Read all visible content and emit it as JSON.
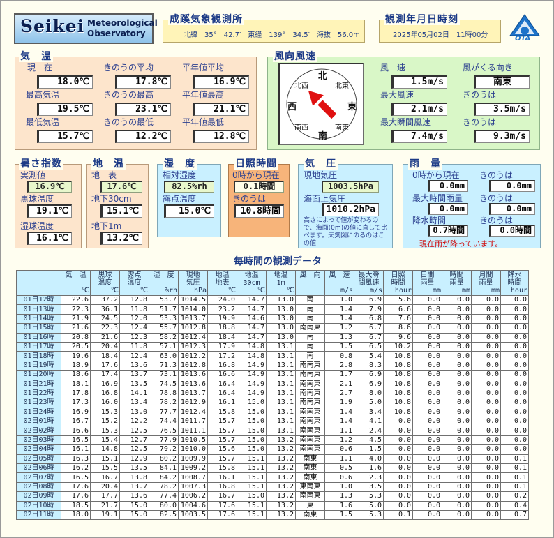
{
  "logo": {
    "word": "Seikei",
    "line1": "Meteorological",
    "line2": "Observatory"
  },
  "station": {
    "title": "成蹊気象観測所",
    "coords": "北緯　35°　42.7′　東経　139°　34.5′　海抜　56.0m"
  },
  "datetime": {
    "title": "観測年月日時刻",
    "value": "2025年05月02日　11時00分"
  },
  "corner_logo": "OTA",
  "temp": {
    "title": "気　温",
    "now_label": "現　在",
    "now": "18.0℃",
    "yavg_label": "きのうの平均",
    "yavg": "17.8℃",
    "navg_label": "平年値平均",
    "navg": "16.9℃",
    "max_label": "最高気温",
    "max": "19.5℃",
    "ymax_label": "きのうの最高",
    "ymax": "23.1℃",
    "nmax_label": "平年値最高",
    "nmax": "21.1℃",
    "min_label": "最低気温",
    "min": "15.7℃",
    "ymin_label": "きのうの最低",
    "ymin": "12.2℃",
    "nmin_label": "平年値最低",
    "nmin": "12.8℃"
  },
  "wind": {
    "title": "風向風速",
    "compass": {
      "n": "北",
      "s": "南",
      "e": "東",
      "w": "西",
      "nw": "北西",
      "ne": "北東",
      "sw": "南西",
      "se": "南東"
    },
    "speed_label": "風　速",
    "speed": "1.5m/s",
    "blow_label": "風がくる向き",
    "blow": "南東",
    "max_label": "最大風速",
    "max": "2.1m/s",
    "ymax_label": "きのうは",
    "ymax": "3.5m/s",
    "gust_label": "最大瞬間風速",
    "gust": "7.4m/s",
    "ygust_label": "きのうは",
    "ygust": "9.3m/s",
    "arrow_color": "#e01010"
  },
  "heat": {
    "title": "暑さ指数",
    "v1_label": "実測値",
    "v1": "16.9℃",
    "v2_label": "黒球温度",
    "v2": "19.1℃",
    "v3_label": "湿球温度",
    "v3": "16.1℃"
  },
  "soil": {
    "title": "地　温",
    "v1_label": "地　表",
    "v1": "17.6℃",
    "v2_label": "地下30cm",
    "v2": "15.1℃",
    "v3_label": "地下1m",
    "v3": "13.2℃"
  },
  "humidity": {
    "title": "湿　度",
    "rh_label": "相対湿度",
    "rh": "82.5%rh",
    "dew_label": "露点温度",
    "dew": "15.0℃"
  },
  "sunshine": {
    "title": "日照時間",
    "since_label": "0時から現在",
    "since": "0.1時間",
    "yest_label": "きのうは",
    "yest": "10.8時間"
  },
  "pressure": {
    "title": "気　圧",
    "stn_label": "現地気圧",
    "stn": "1003.5hPa",
    "sea_label": "海面上気圧",
    "sea": "1010.2hPa",
    "note": "高さによって値が変わるので、海面(0m)の値に直して比べます。天気図にのるのはこの値"
  },
  "rain": {
    "title": "雨　量",
    "since_label": "0時から現在",
    "since": "0.0mm",
    "ysince_label": "きのうは",
    "ysince": "0.0mm",
    "maxh_label": "最大時間雨量",
    "maxh": "0.0mm",
    "ymaxh_label": "きのうは",
    "ymaxh": "0.0mm",
    "dur_label": "降水時間",
    "dur": "0.7時間",
    "ydur_label": "きのうは",
    "ydur": "0.0時間",
    "status": "現在雨が降っています。"
  },
  "table": {
    "title": "毎時間の観測データ",
    "headers": [
      [
        "",
        "気　温",
        "",
        "℃"
      ],
      [
        "",
        "黒球",
        "温度",
        "℃"
      ],
      [
        "",
        "露点",
        "温度",
        "℃"
      ],
      [
        "",
        "湿　度",
        "",
        "%rh"
      ],
      [
        "",
        "現地",
        "気圧",
        "hPa"
      ],
      [
        "",
        "地温",
        "地表",
        "℃"
      ],
      [
        "",
        "地温",
        "30cm",
        "℃"
      ],
      [
        "",
        "地温",
        "1m",
        "℃"
      ],
      [
        "",
        "風　向",
        "",
        ""
      ],
      [
        "",
        "風　速",
        "",
        "m/s"
      ],
      [
        "",
        "最大瞬",
        "間風速",
        "m/s"
      ],
      [
        "",
        "日照",
        "時間",
        "hour"
      ],
      [
        "",
        "日間",
        "雨量",
        "mm"
      ],
      [
        "",
        "時間",
        "雨量",
        "mm"
      ],
      [
        "",
        "月間",
        "雨量",
        "mm"
      ],
      [
        "",
        "降水",
        "時間",
        "hour"
      ]
    ],
    "rows": [
      [
        "01日12時",
        "22.6",
        "37.2",
        "12.8",
        "53.7",
        "1014.5",
        "24.0",
        "14.7",
        "13.0",
        "南",
        "1.0",
        "6.9",
        "5.6",
        "0.0",
        "0.0",
        "0.0",
        "0.0"
      ],
      [
        "01日13時",
        "22.3",
        "36.1",
        "11.8",
        "51.7",
        "1014.0",
        "23.2",
        "14.7",
        "13.0",
        "南",
        "1.4",
        "7.9",
        "6.6",
        "0.0",
        "0.0",
        "0.0",
        "0.0"
      ],
      [
        "01日14時",
        "21.9",
        "24.5",
        "12.0",
        "53.3",
        "1013.7",
        "19.9",
        "14.6",
        "13.0",
        "南",
        "1.4",
        "6.8",
        "7.6",
        "0.0",
        "0.0",
        "0.0",
        "0.0"
      ],
      [
        "01日15時",
        "21.6",
        "22.3",
        "12.4",
        "55.7",
        "1012.8",
        "18.8",
        "14.7",
        "13.0",
        "南南東",
        "1.2",
        "6.7",
        "8.6",
        "0.0",
        "0.0",
        "0.0",
        "0.0"
      ],
      [
        "01日16時",
        "20.8",
        "21.6",
        "12.3",
        "58.2",
        "1012.4",
        "18.4",
        "14.7",
        "13.0",
        "南",
        "1.3",
        "6.7",
        "9.6",
        "0.0",
        "0.0",
        "0.0",
        "0.0"
      ],
      [
        "01日17時",
        "20.5",
        "20.4",
        "11.8",
        "57.1",
        "1012.3",
        "17.9",
        "14.8",
        "13.1",
        "南",
        "1.5",
        "6.5",
        "10.2",
        "0.0",
        "0.0",
        "0.0",
        "0.0"
      ],
      [
        "01日18時",
        "19.6",
        "18.4",
        "12.4",
        "63.0",
        "1012.2",
        "17.2",
        "14.8",
        "13.1",
        "南",
        "0.8",
        "5.4",
        "10.8",
        "0.0",
        "0.0",
        "0.0",
        "0.0"
      ],
      [
        "01日19時",
        "18.9",
        "17.6",
        "13.6",
        "71.3",
        "1012.8",
        "16.8",
        "14.9",
        "13.1",
        "南南東",
        "2.8",
        "8.3",
        "10.8",
        "0.0",
        "0.0",
        "0.0",
        "0.0"
      ],
      [
        "01日20時",
        "18.6",
        "17.4",
        "13.7",
        "73.1",
        "1013.6",
        "16.6",
        "14.9",
        "13.1",
        "南南東",
        "1.7",
        "6.9",
        "10.8",
        "0.0",
        "0.0",
        "0.0",
        "0.0"
      ],
      [
        "01日21時",
        "18.1",
        "16.9",
        "13.5",
        "74.5",
        "1013.6",
        "16.4",
        "14.9",
        "13.1",
        "南南東",
        "2.1",
        "6.9",
        "10.8",
        "0.0",
        "0.0",
        "0.0",
        "0.0"
      ],
      [
        "01日22時",
        "17.8",
        "16.8",
        "14.1",
        "78.8",
        "1013.7",
        "16.4",
        "14.9",
        "13.1",
        "南南東",
        "2.7",
        "8.0",
        "10.8",
        "0.0",
        "0.0",
        "0.0",
        "0.0"
      ],
      [
        "01日23時",
        "17.3",
        "16.0",
        "13.4",
        "78.2",
        "1012.9",
        "16.1",
        "15.0",
        "13.1",
        "南南東",
        "1.9",
        "5.0",
        "10.8",
        "0.0",
        "0.0",
        "0.0",
        "0.0"
      ],
      [
        "01日24時",
        "16.9",
        "15.3",
        "13.0",
        "77.7",
        "1012.4",
        "15.8",
        "15.0",
        "13.1",
        "南南東",
        "1.4",
        "3.4",
        "10.8",
        "0.0",
        "0.0",
        "0.0",
        "0.0"
      ],
      [
        "02日01時",
        "16.7",
        "15.2",
        "12.2",
        "74.4",
        "1011.7",
        "15.7",
        "15.0",
        "13.1",
        "南南東",
        "1.4",
        "4.1",
        "0.0",
        "0.0",
        "0.0",
        "0.0",
        "0.0"
      ],
      [
        "02日02時",
        "16.6",
        "15.3",
        "12.5",
        "76.5",
        "1011.1",
        "15.7",
        "15.0",
        "13.1",
        "南南東",
        "1.1",
        "2.4",
        "0.0",
        "0.0",
        "0.0",
        "0.0",
        "0.0"
      ],
      [
        "02日03時",
        "16.5",
        "15.4",
        "12.7",
        "77.9",
        "1010.5",
        "15.7",
        "15.0",
        "13.2",
        "南南東",
        "1.2",
        "4.5",
        "0.0",
        "0.0",
        "0.0",
        "0.0",
        "0.0"
      ],
      [
        "02日04時",
        "16.1",
        "14.8",
        "12.5",
        "79.2",
        "1010.0",
        "15.6",
        "15.0",
        "13.2",
        "南南東",
        "0.6",
        "1.5",
        "0.0",
        "0.0",
        "0.0",
        "0.0",
        "0.0"
      ],
      [
        "02日05時",
        "16.3",
        "15.1",
        "12.9",
        "80.2",
        "1009.9",
        "15.7",
        "15.1",
        "13.2",
        "南東",
        "1.1",
        "4.0",
        "0.0",
        "0.0",
        "0.0",
        "0.0",
        "0.1"
      ],
      [
        "02日06時",
        "16.2",
        "15.5",
        "13.5",
        "84.1",
        "1009.2",
        "15.8",
        "15.1",
        "13.2",
        "南東",
        "0.5",
        "1.6",
        "0.0",
        "0.0",
        "0.0",
        "0.0",
        "0.1"
      ],
      [
        "02日07時",
        "16.5",
        "16.7",
        "13.8",
        "84.2",
        "1008.7",
        "16.1",
        "15.1",
        "13.2",
        "南東",
        "0.6",
        "2.3",
        "0.0",
        "0.0",
        "0.0",
        "0.0",
        "0.1"
      ],
      [
        "02日08時",
        "17.6",
        "20.4",
        "13.7",
        "78.2",
        "1007.3",
        "16.8",
        "15.1",
        "13.2",
        "東南東",
        "1.0",
        "3.5",
        "0.0",
        "0.0",
        "0.0",
        "0.0",
        "0.1"
      ],
      [
        "02日09時",
        "17.6",
        "17.7",
        "13.6",
        "77.4",
        "1006.2",
        "16.7",
        "15.0",
        "13.2",
        "南南東",
        "1.3",
        "5.3",
        "0.0",
        "0.0",
        "0.0",
        "0.0",
        "0.2"
      ],
      [
        "02日10時",
        "18.5",
        "21.7",
        "15.0",
        "80.0",
        "1004.6",
        "17.6",
        "15.1",
        "13.2",
        "東",
        "1.6",
        "5.0",
        "0.0",
        "0.0",
        "0.0",
        "0.0",
        "0.4"
      ],
      [
        "02日11時",
        "18.0",
        "19.1",
        "15.0",
        "82.5",
        "1003.5",
        "17.6",
        "15.1",
        "13.2",
        "南東",
        "1.5",
        "5.3",
        "0.1",
        "0.0",
        "0.0",
        "0.0",
        "0.7"
      ]
    ]
  }
}
